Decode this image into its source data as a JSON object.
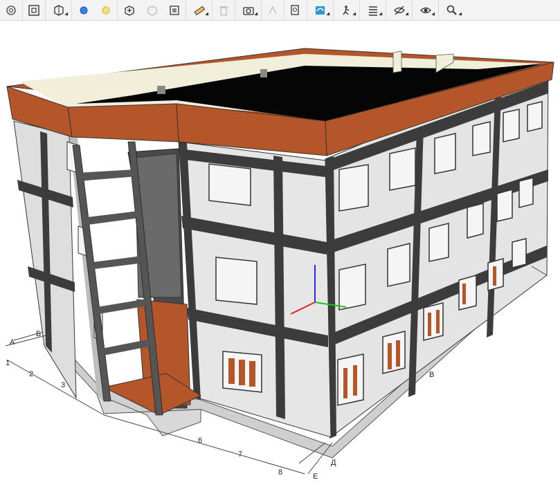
{
  "toolbar": {
    "buttons": [
      {
        "name": "settings-icon",
        "dropdown": false,
        "disabled": false
      },
      {
        "name": "fit-view-icon",
        "dropdown": false,
        "disabled": false
      },
      {
        "name": "view-cube-icon",
        "dropdown": true,
        "disabled": false
      },
      {
        "name": "blue-point-icon",
        "dropdown": false,
        "disabled": false
      },
      {
        "name": "yellow-point-icon",
        "dropdown": false,
        "disabled": false
      },
      {
        "name": "add-model-icon",
        "dropdown": false,
        "disabled": false
      },
      {
        "name": "section-icon",
        "dropdown": false,
        "disabled": true
      },
      {
        "name": "section-box-icon",
        "dropdown": false,
        "disabled": false
      },
      {
        "name": "measure-ruler-icon",
        "dropdown": true,
        "disabled": false
      },
      {
        "name": "delete-icon",
        "dropdown": false,
        "disabled": true
      },
      {
        "name": "camera-icon",
        "dropdown": true,
        "disabled": false
      },
      {
        "name": "explode-icon",
        "dropdown": false,
        "disabled": true
      },
      {
        "name": "export-report-icon",
        "dropdown": false,
        "disabled": false
      },
      {
        "name": "layers-icon",
        "dropdown": true,
        "disabled": false
      },
      {
        "name": "walk-mode-icon",
        "dropdown": true,
        "disabled": false
      },
      {
        "name": "list-icon",
        "dropdown": true,
        "disabled": false
      },
      {
        "name": "hide-icon",
        "dropdown": true,
        "disabled": false
      },
      {
        "name": "show-icon",
        "dropdown": true,
        "disabled": false
      },
      {
        "name": "zoom-search-icon",
        "dropdown": true,
        "disabled": false
      }
    ]
  },
  "grid_axes": {
    "left_numbers": [
      "1",
      "2",
      "3"
    ],
    "left_letters": [
      "А",
      "Б"
    ],
    "front_numbers": [
      "6",
      "7",
      "8"
    ],
    "front_letters": [
      "Д",
      "Е"
    ],
    "right_letters": [
      "В"
    ]
  },
  "colors": {
    "accent_orange": "#b4562a",
    "panel_light": "#e3e3e3",
    "frame_dark": "#3c3c3c",
    "roof_black": "#050505",
    "parapet_cream": "#f1efd9",
    "axis_x": "#e02020",
    "axis_y": "#20c020",
    "axis_z": "#2030e0"
  }
}
